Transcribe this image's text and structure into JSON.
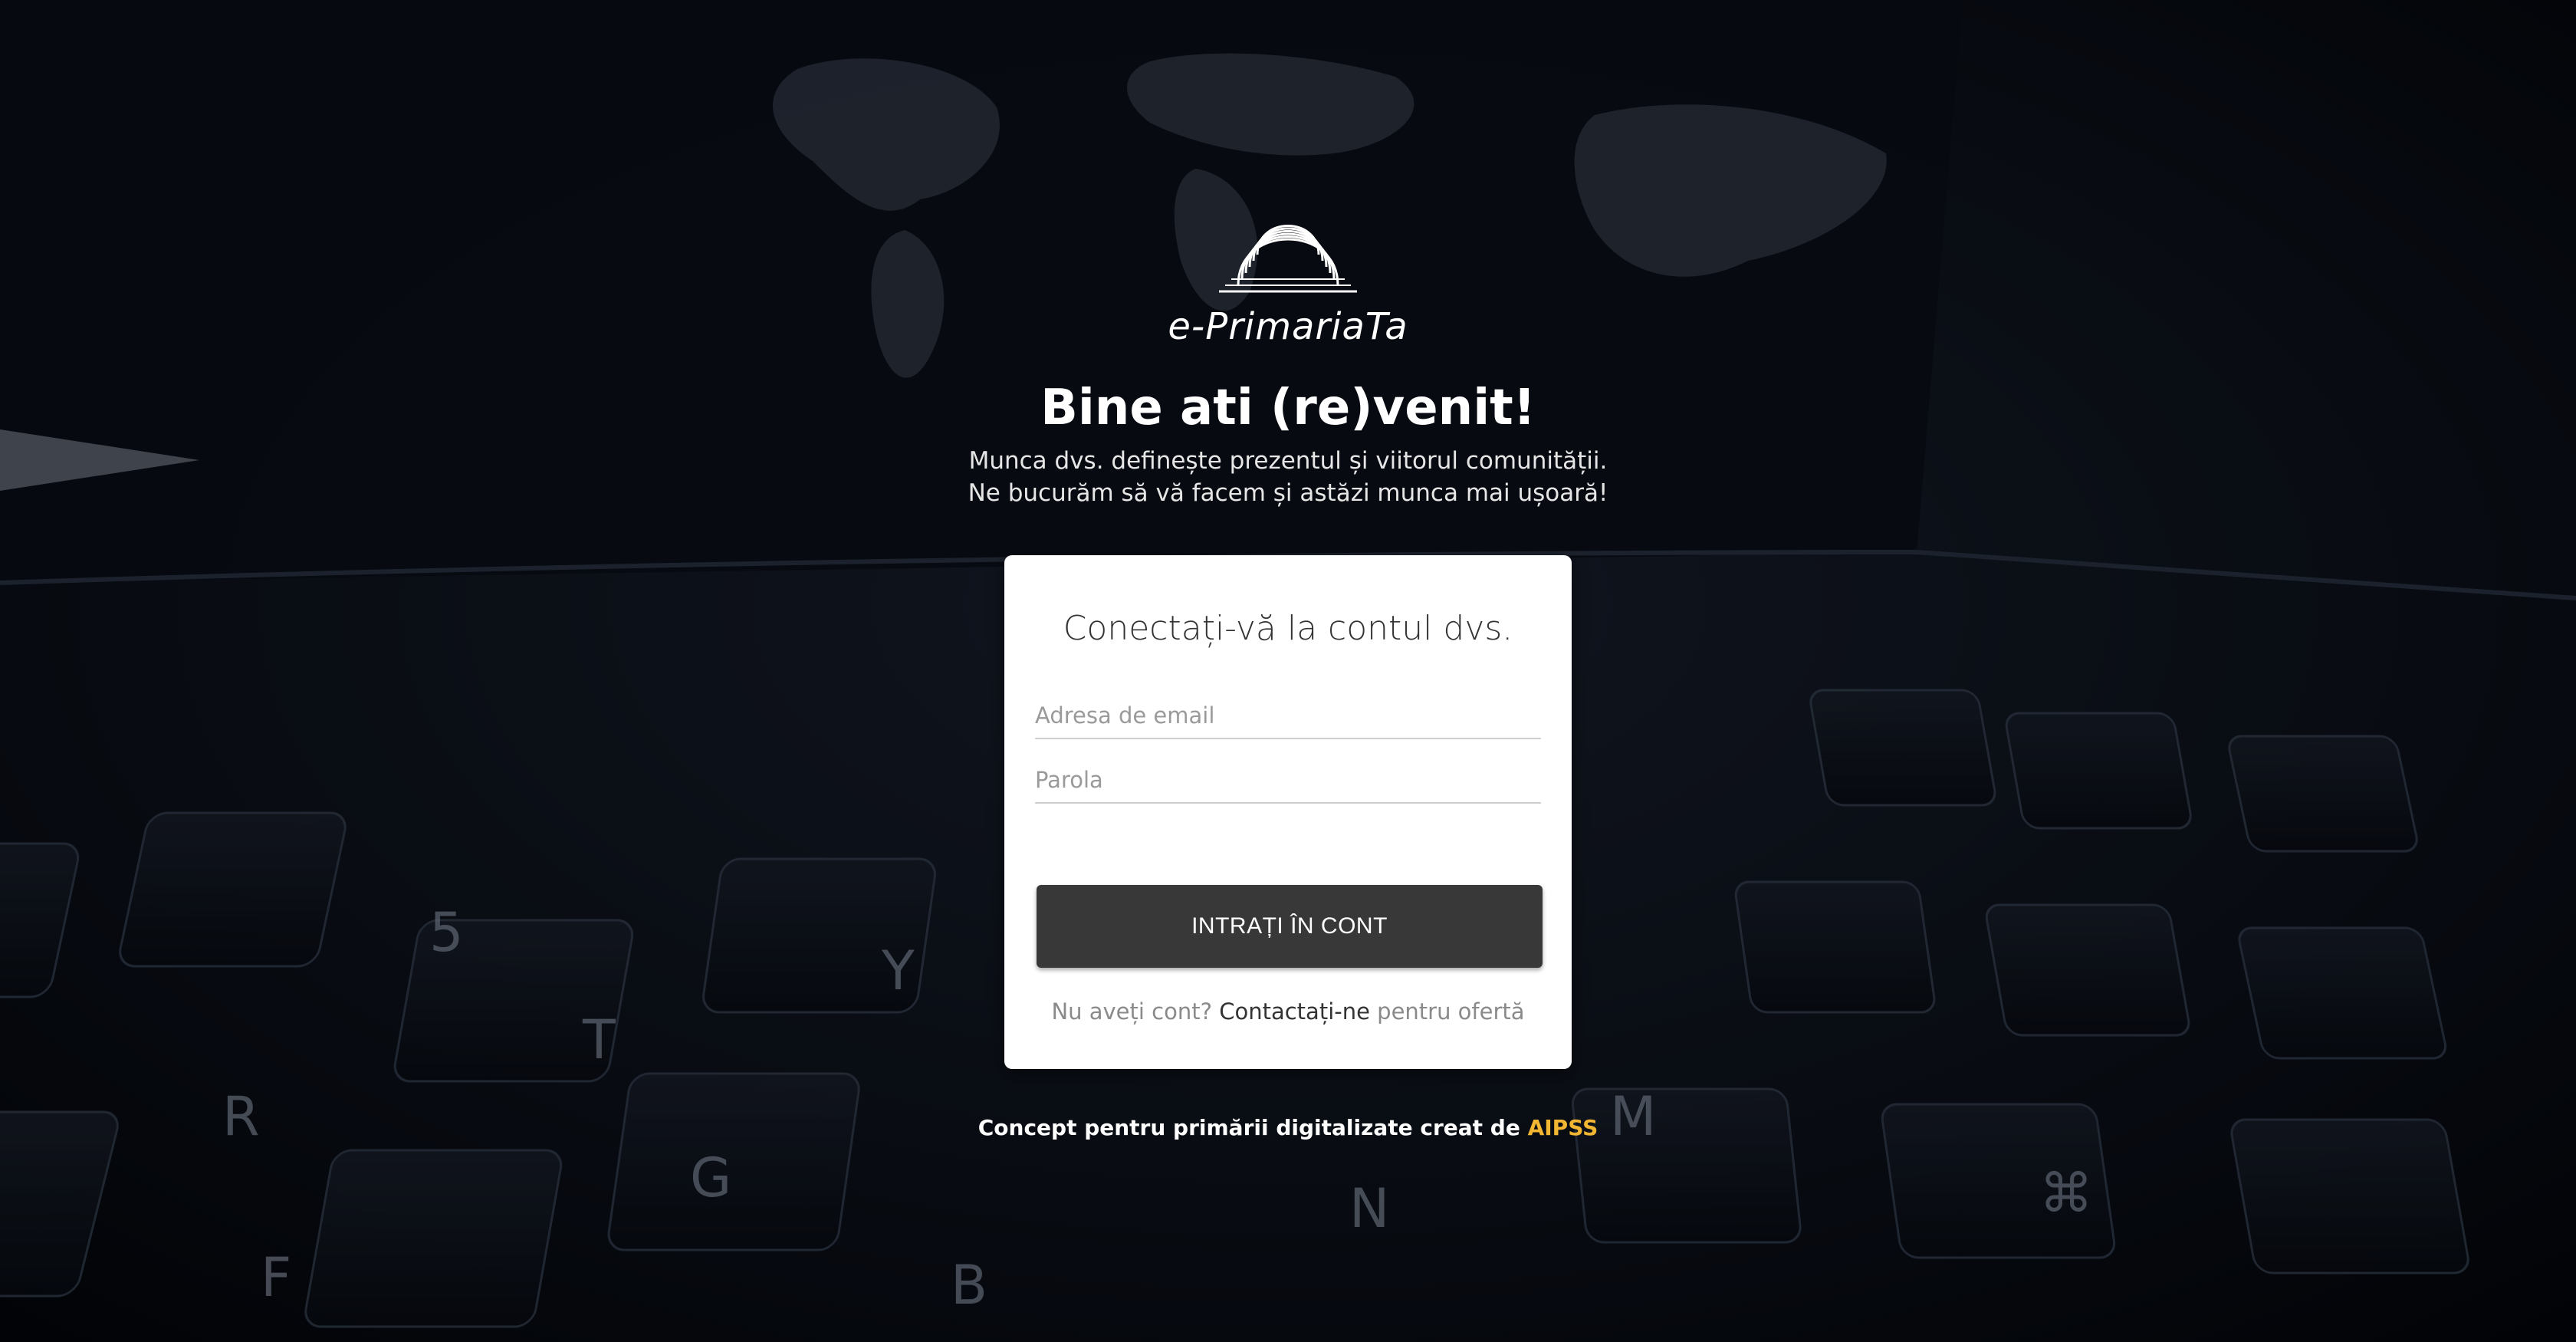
{
  "brand": {
    "name": "e-PrimariaTa"
  },
  "hero": {
    "title": "Bine ati (re)venit!",
    "line1": "Munca dvs. definește prezentul și viitorul comunității.",
    "line2": "Ne bucurăm să vă facem și astăzi munca mai ușoară!"
  },
  "login": {
    "title": "Conectați-vă la contul dvs.",
    "email_placeholder": "Adresa de email",
    "password_placeholder": "Parola",
    "submit_label": "INTRAȚI ÎN CONT",
    "signup_prefix": "Nu aveți cont?",
    "signup_link": "Contactați-ne",
    "signup_suffix": "pentru ofertă"
  },
  "footer": {
    "text": "Concept pentru primării digitalizate creat de",
    "link": "AIPSS"
  },
  "colors": {
    "background": "#070a12",
    "card": "#ffffff",
    "button": "#383838",
    "accent": "#f2b632"
  }
}
